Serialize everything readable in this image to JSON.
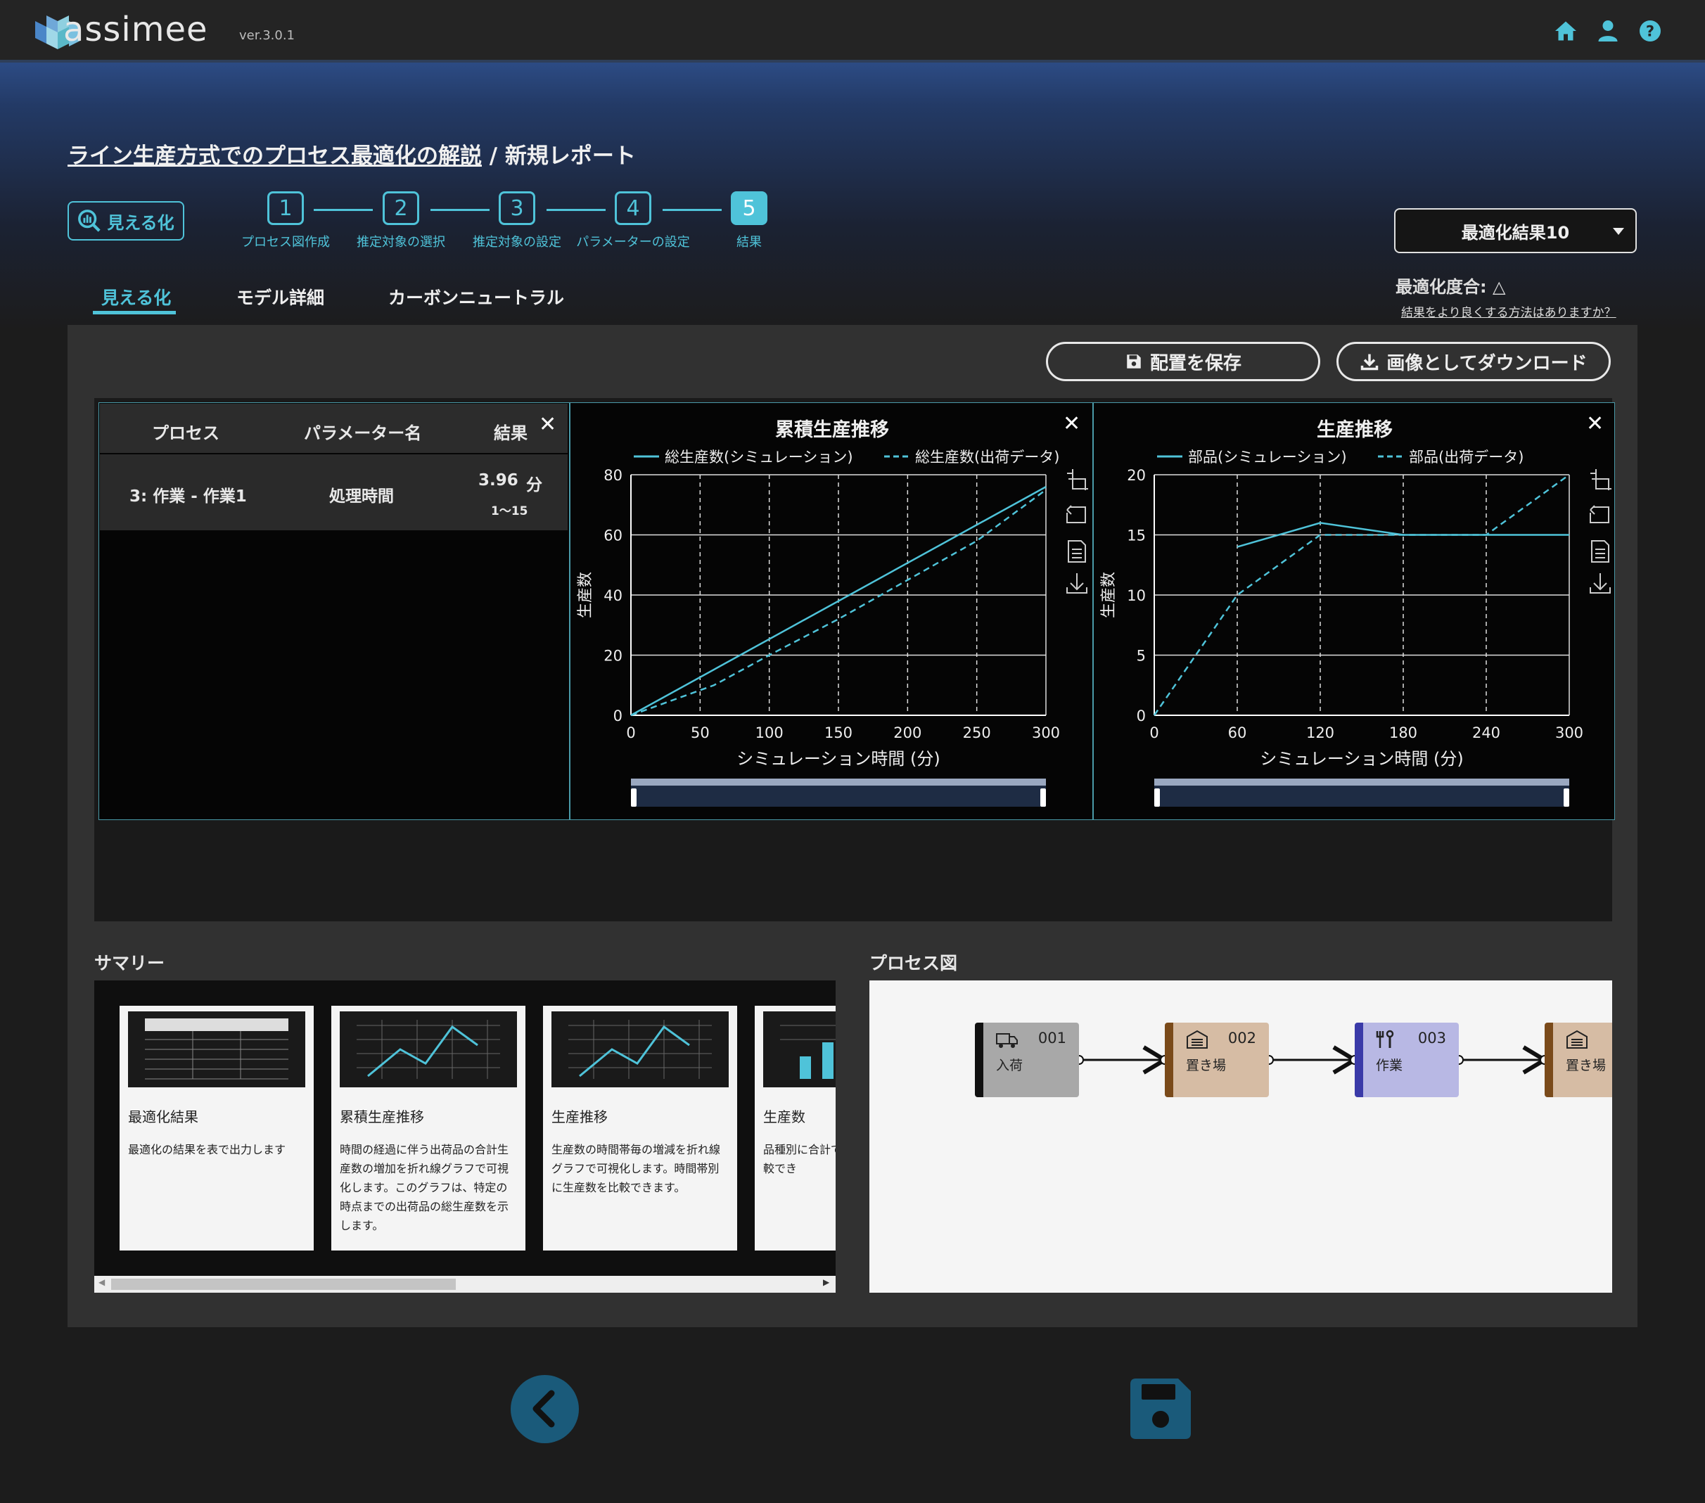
{
  "app": {
    "name": "assimee",
    "version": "ver.3.0.1"
  },
  "header": {
    "icons": [
      "home-icon",
      "user-icon",
      "help-icon"
    ]
  },
  "page": {
    "project_title": "ライン生産方式でのプロセス最適化の解説",
    "separator": " / ",
    "report_title": "新規レポート"
  },
  "visualize_button": {
    "label": "見える化"
  },
  "steps": [
    {
      "num": "1",
      "label": "プロセス図作成"
    },
    {
      "num": "2",
      "label": "推定対象の選択"
    },
    {
      "num": "3",
      "label": "推定対象の設定"
    },
    {
      "num": "4",
      "label": "パラメーターの設定"
    },
    {
      "num": "5",
      "label": "結果"
    }
  ],
  "optimization": {
    "selected": "最適化結果10",
    "degree": "最適化度合: △",
    "help_link": "結果をより良くする方法はありますか？"
  },
  "tabs": [
    {
      "label": "見える化"
    },
    {
      "label": "モデル詳細"
    },
    {
      "label": "カーボンニュートラル"
    }
  ],
  "actions": {
    "save_layout": "配置を保存",
    "download_image": "画像としてダウンロード"
  },
  "result_table": {
    "headers": [
      "プロセス",
      "パラメーター名",
      "結果"
    ],
    "rows": [
      {
        "process": "3: 作業 - 作業1",
        "param": "処理時間",
        "value": "3.96",
        "unit": "分",
        "range": "1～15"
      }
    ]
  },
  "colors": {
    "accent": "#4fc3d9",
    "dark_blue": "#1a5a7a"
  },
  "chart_data": [
    {
      "type": "line",
      "title": "累積生産推移",
      "xlabel": "シミュレーション時間 (分)",
      "ylabel": "生産数",
      "xlim": [
        0,
        300
      ],
      "ylim": [
        0,
        80
      ],
      "xticks": [
        "0",
        "50",
        "100",
        "150",
        "200",
        "250",
        "300"
      ],
      "yticks": [
        "0",
        "20",
        "40",
        "60",
        "80"
      ],
      "legend_position": "top",
      "grid": true,
      "series": [
        {
          "name": "総生産数(シミュレーション)",
          "style": "solid",
          "x": [
            0,
            300
          ],
          "y": [
            0,
            76
          ]
        },
        {
          "name": "総生産数(出荷データ)",
          "style": "dashed",
          "x": [
            0,
            60,
            100,
            150,
            200,
            250,
            300
          ],
          "y": [
            0,
            10,
            20,
            32,
            45,
            58,
            75
          ]
        }
      ]
    },
    {
      "type": "line",
      "title": "生産推移",
      "xlabel": "シミュレーション時間 (分)",
      "ylabel": "生産数",
      "xlim": [
        0,
        300
      ],
      "ylim": [
        0,
        20
      ],
      "xticks": [
        "0",
        "60",
        "120",
        "180",
        "240",
        "300"
      ],
      "yticks": [
        "0",
        "5",
        "10",
        "15",
        "20"
      ],
      "legend_position": "top",
      "grid": true,
      "series": [
        {
          "name": "部品(シミュレーション)",
          "style": "solid",
          "x": [
            60,
            120,
            180,
            240,
            300
          ],
          "y": [
            14,
            16,
            15,
            15,
            15
          ]
        },
        {
          "name": "部品(出荷データ)",
          "style": "dashed",
          "x": [
            0,
            60,
            120,
            180,
            240,
            300
          ],
          "y": [
            0,
            10,
            15,
            15,
            15,
            20
          ]
        }
      ]
    }
  ],
  "summary": {
    "title": "サマリー",
    "cards": [
      {
        "title": "最適化結果",
        "desc": "最適化の結果を表で出力します"
      },
      {
        "title": "累積生産推移",
        "desc": "時間の経過に伴う出荷品の合計生産数の増加を折れ線グラフで可視化します。このグラフは、特定の時点までの出荷品の総生産数を示します。"
      },
      {
        "title": "生産推移",
        "desc": "生産数の時間帯毎の増減を折れ線グラフで可視化します。時間帯別に生産数を比較できます。"
      },
      {
        "title": "生産数",
        "desc": "品種別に合計で可視化しま数を比較でき"
      }
    ]
  },
  "process_diagram": {
    "title": "プロセス図",
    "nodes": [
      {
        "num": "001",
        "label": "入荷",
        "icon": "truck-icon",
        "color": "#a8a8a8",
        "stripe": "#111"
      },
      {
        "num": "002",
        "label": "置き場",
        "icon": "warehouse-icon",
        "color": "#d6bca4",
        "stripe": "#7a4a1a"
      },
      {
        "num": "003",
        "label": "作業",
        "icon": "tools-icon",
        "color": "#b8b8e4",
        "stripe": "#3a3aa8"
      },
      {
        "num": "",
        "label": "置き場",
        "icon": "warehouse-icon",
        "color": "#d6bca4",
        "stripe": "#7a4a1a"
      }
    ]
  }
}
